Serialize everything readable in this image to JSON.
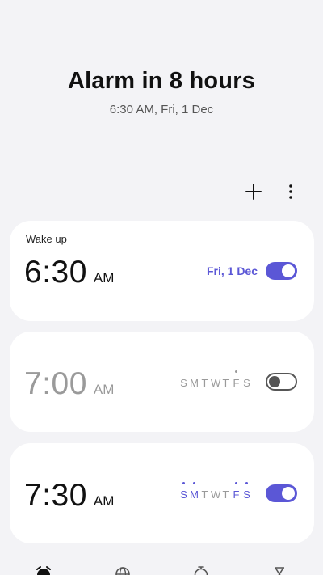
{
  "header": {
    "title": "Alarm in 8 hours",
    "subtitle": "6:30 AM, Fri, 1 Dec"
  },
  "toolbar": {
    "add_icon": "plus-icon",
    "more_icon": "more-vertical-icon"
  },
  "alarms": [
    {
      "label": "Wake up",
      "time": "6:30",
      "ampm": "AM",
      "date": "Fri, 1 Dec",
      "enabled": true
    },
    {
      "label": "",
      "time": "7:00",
      "ampm": "AM",
      "days": [
        "S",
        "M",
        "T",
        "W",
        "T",
        "F",
        "S"
      ],
      "active_days": [
        false,
        false,
        false,
        false,
        false,
        true,
        false
      ],
      "enabled": false
    },
    {
      "label": "",
      "time": "7:30",
      "ampm": "AM",
      "days": [
        "S",
        "M",
        "T",
        "W",
        "T",
        "F",
        "S"
      ],
      "active_days": [
        true,
        true,
        false,
        false,
        false,
        true,
        true
      ],
      "enabled": true
    }
  ],
  "nav": {
    "items": [
      "alarm-icon",
      "world-clock-icon",
      "stopwatch-icon",
      "timer-icon"
    ]
  },
  "colors": {
    "accent": "#5b57d6",
    "background": "#f3f3f6",
    "card": "#ffffff"
  }
}
